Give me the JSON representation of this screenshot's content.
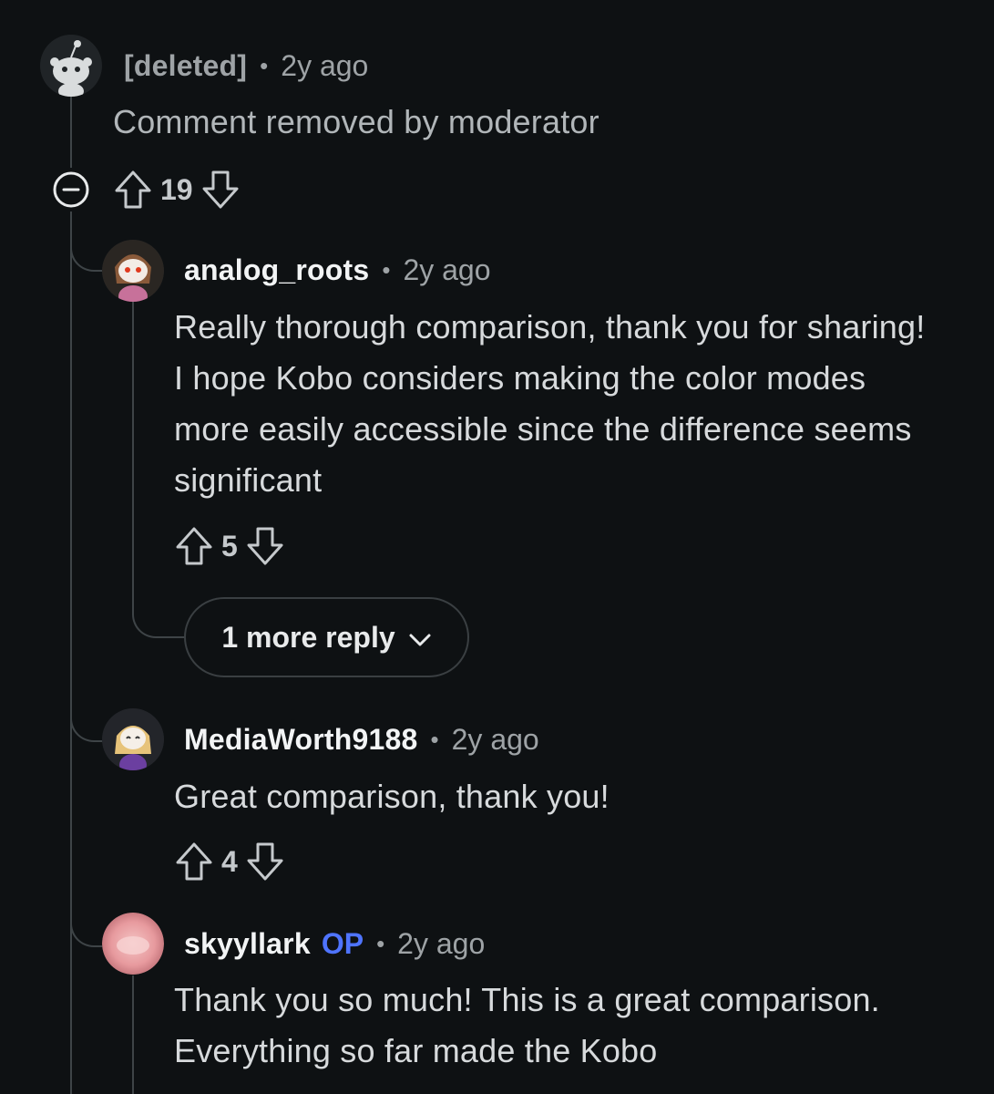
{
  "comments": [
    {
      "username": "[deleted]",
      "time": "2y ago",
      "body": "Comment removed by moderator",
      "votes": "19",
      "avatar_icon": "snoo-deleted-icon"
    },
    {
      "username": "analog_roots",
      "time": "2y ago",
      "body": "Really thorough comparison, thank you for sharing! I hope Kobo considers making the color modes more easily accessible since the difference seems significant",
      "votes": "5",
      "more_replies": "1 more reply",
      "avatar_icon": "snoo-avatar-icon"
    },
    {
      "username": "MediaWorth9188",
      "time": "2y ago",
      "body": "Great comparison, thank you!",
      "votes": "4",
      "avatar_icon": "snoo-avatar-icon"
    },
    {
      "username": "skyyllark",
      "op_badge": "OP",
      "time": "2y ago",
      "body": "Thank you so much! This is a great comparison. Everything so far made the Kobo",
      "avatar_icon": "pink-avatar-icon"
    }
  ],
  "separator": "•",
  "colors": {
    "background": "#0e1113",
    "op_accent": "#4f74ff",
    "thread_line": "#3e4447"
  }
}
